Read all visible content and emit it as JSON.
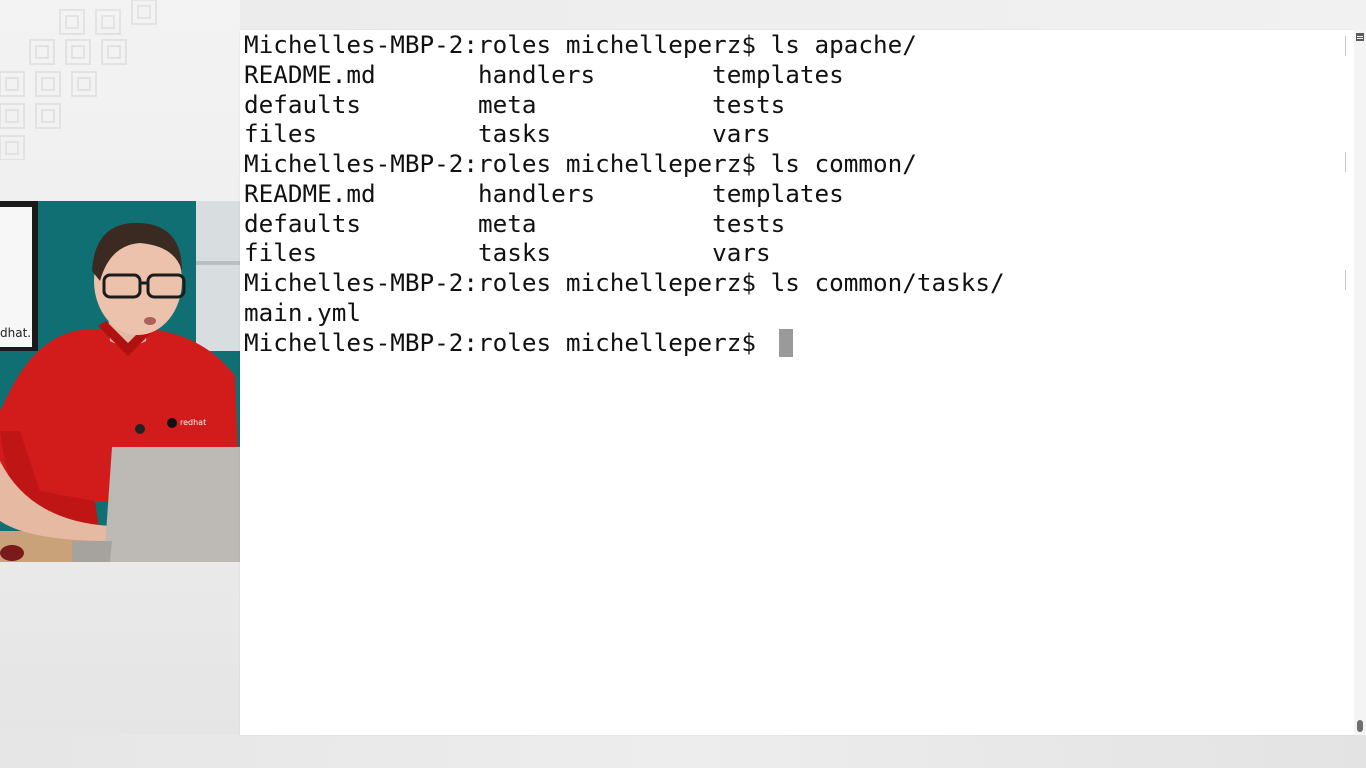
{
  "terminal": {
    "lines": [
      "Michelles-MBP-2:roles michelleperz$ ls apache/",
      "README.md       handlers        templates",
      "defaults        meta            tests",
      "files           tasks           vars",
      "Michelles-MBP-2:roles michelleperz$ ls common/",
      "README.md       handlers        templates",
      "defaults        meta            tests",
      "files           tasks           vars",
      "Michelles-MBP-2:roles michelleperz$ ls common/tasks/",
      "main.yml",
      "Michelles-MBP-2:roles michelleperz$ "
    ]
  },
  "presenter": {
    "laptop_logo": "dhat.",
    "shirt_logo": "redhat"
  },
  "colors": {
    "terminal_bg": "#ffffff",
    "terminal_text": "#111111",
    "cursor": "#9a9a9a",
    "shirt": "#d21c1c",
    "backdrop": "#0f6f73"
  },
  "icons": {
    "scrollbar_top": "scroll-top-icon",
    "presenter": "presenter-video"
  }
}
